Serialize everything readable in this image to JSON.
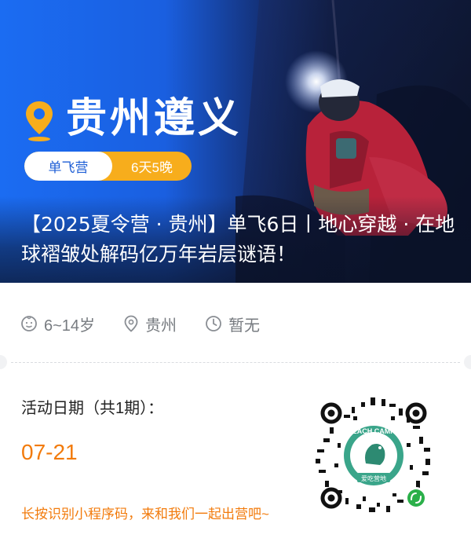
{
  "hero": {
    "title": "贵州遵义",
    "camp_type": "单飞营",
    "duration": "6天5晚",
    "headline": "【2025夏令营 · 贵州】单飞6日丨地心穿越 · 在地球褶皱处解码亿万年岩层谜语！"
  },
  "meta": {
    "age": "6~14岁",
    "location": "贵州",
    "time": "暂无"
  },
  "schedule": {
    "label": "活动日期（共1期）：",
    "date": "07-21",
    "hint": "长按识别小程序码，来和我们一起出营吧~"
  },
  "qr": {
    "brand": "EACH CAMP",
    "brand_cn": "爱吃营地"
  },
  "colors": {
    "accent_orange": "#f27b0c",
    "pill_yellow": "#f7ad1c",
    "hero_blue": "#1b6cf2",
    "qr_green": "#3aa58a"
  }
}
